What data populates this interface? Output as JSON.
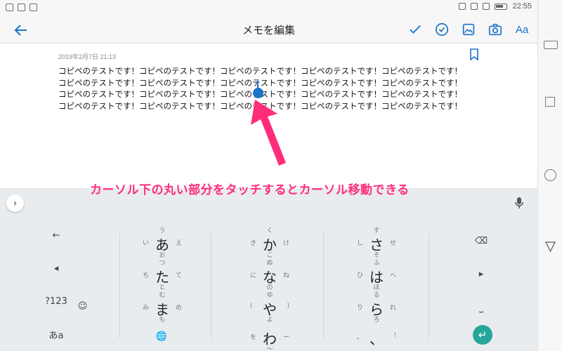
{
  "status_bar": {
    "time": "22:55"
  },
  "action_bar": {
    "title": "メモを編集",
    "font_button_label": "Aa"
  },
  "note": {
    "date": "2019年2月7日 21:13",
    "lines": [
      "コピペのテストです！コピペのテストです！コピペのテストです！コピペのテストです！コピペのテストです！",
      "コピペのテストです！コピペのテストです！コピペのテストです！コピペのテストです！コピペのテストです！",
      "コピペのテストです！コピペのテストです！コピペのテストです！コピペのテストです！コピペのテストです！",
      "コピペのテストです！コピペのテストです！コピペのテストです！コピペのテストです！コピペのテストです！"
    ]
  },
  "annotation": "カーソル下の丸い部分をタッチするとカーソル移動できる",
  "keyboard": {
    "expand_label": "›",
    "left_keys": [
      "←",
      "◂",
      "?123",
      "あa"
    ],
    "right_keys": [
      "⌫",
      "▸",
      "⎵",
      "↵"
    ],
    "emoji_label": "☺",
    "globe_label": "🌐",
    "kana": [
      {
        "main": "あ",
        "top": "う",
        "left": "い",
        "right": "え",
        "bot": "お"
      },
      {
        "main": "か",
        "top": "く",
        "left": "き",
        "right": "け",
        "bot": "こ"
      },
      {
        "main": "さ",
        "top": "す",
        "left": "し",
        "right": "せ",
        "bot": "そ"
      },
      {
        "main": "た",
        "top": "つ",
        "left": "ち",
        "right": "て",
        "bot": "と"
      },
      {
        "main": "な",
        "top": "ぬ",
        "left": "に",
        "right": "ね",
        "bot": "の"
      },
      {
        "main": "は",
        "top": "ふ",
        "left": "ひ",
        "right": "へ",
        "bot": "ほ"
      },
      {
        "main": "ま",
        "top": "む",
        "left": "み",
        "right": "め",
        "bot": "も"
      },
      {
        "main": "や",
        "top": "ゆ",
        "left": "(",
        "right": ")",
        "bot": "よ"
      },
      {
        "main": "ら",
        "top": "る",
        "left": "り",
        "right": "れ",
        "bot": "ろ"
      },
      {
        "main": "わ",
        "top": "ん",
        "left": "を",
        "right": "ー",
        "bot": "〜"
      },
      {
        "main": "、",
        "top": "?",
        "left": "。",
        "right": "!",
        "bot": "…"
      }
    ]
  },
  "colors": {
    "accent": "#1a73c8",
    "annotation": "#ff2d7a",
    "enter": "#26a69a"
  }
}
